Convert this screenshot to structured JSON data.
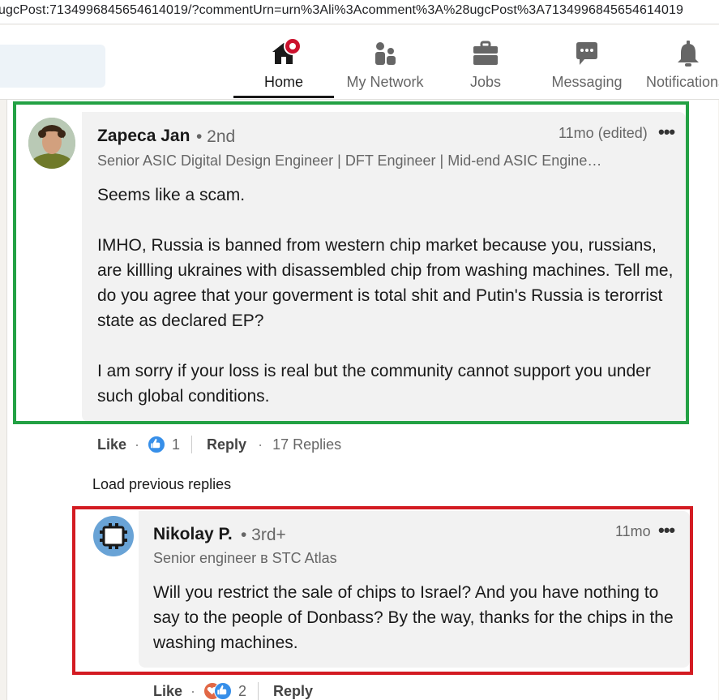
{
  "browser": {
    "url": "ugcPost:7134996845654614019/?commentUrn=urn%3Ali%3Acomment%3A%28ugcPost%3A7134996845654614019"
  },
  "nav": {
    "items": [
      {
        "label": "Home",
        "icon": "home-icon",
        "active": true,
        "badge": true
      },
      {
        "label": "My Network",
        "icon": "people-icon",
        "active": false
      },
      {
        "label": "Jobs",
        "icon": "briefcase-icon",
        "active": false
      },
      {
        "label": "Messaging",
        "icon": "chat-icon",
        "active": false
      },
      {
        "label": "Notifications",
        "icon": "bell-icon",
        "active": false
      }
    ],
    "badge_color": "#cb112d"
  },
  "comments": [
    {
      "author": "Zapeca Jan",
      "degree": "• 2nd",
      "headline": "Senior ASIC Digital Design Engineer | DFT Engineer | Mid-end ASIC Engine…",
      "time": "11mo (edited)",
      "more": "•••",
      "paragraphs": [
        "Seems like a scam.",
        "IMHO, Russia is banned from western chip market because you, russians, are killling ukraines with disassembled chip from washing machines. Tell me, do you agree that your goverment is total shit and Putin's Russia is terorrist state as declared EP?",
        "I am sorry if your loss is real but the community cannot support you under such global conditions."
      ],
      "actions": {
        "like": "Like",
        "reaction_count": "1",
        "reply": "Reply",
        "replies": "17 Replies"
      },
      "highlight_color": "#23a144"
    },
    {
      "author": "Nikolay P.",
      "degree": "• 3rd+",
      "headline": "Senior engineer в STC Atlas",
      "time": "11mo",
      "more": "•••",
      "paragraphs": [
        "Will you restrict the sale of chips to Israel? And you have nothing to say to the people of Donbass? By the way, thanks for the chips in the washing machines."
      ],
      "actions": {
        "like": "Like",
        "reaction_count": "2",
        "reply": "Reply"
      },
      "highlight_color": "#d31b22"
    }
  ],
  "load_previous": "Load previous replies",
  "separator": "·"
}
